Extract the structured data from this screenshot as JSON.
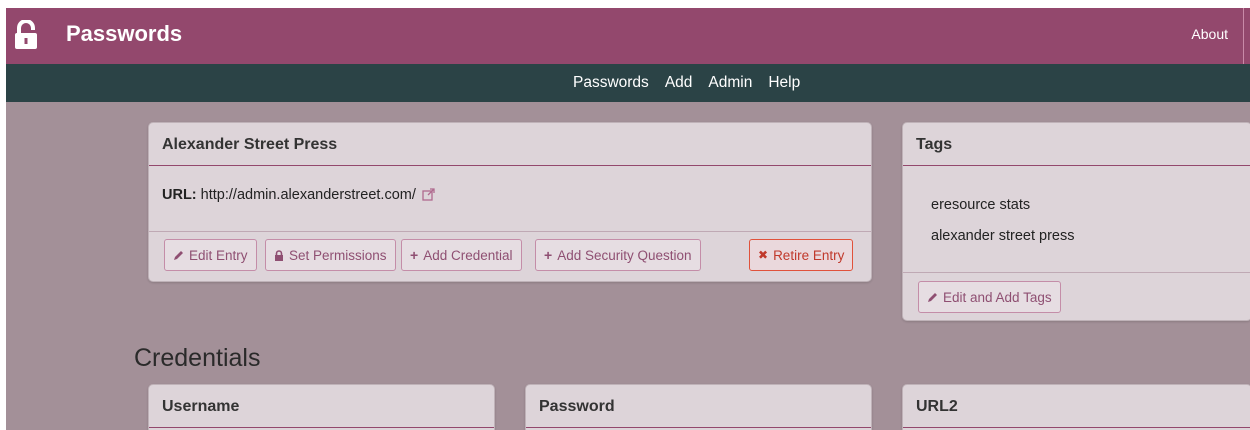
{
  "header": {
    "app_title": "Passwords",
    "about_label": "About"
  },
  "nav": {
    "items": [
      "Passwords",
      "Add",
      "Admin",
      "Help"
    ]
  },
  "entry": {
    "title": "Alexander Street Press",
    "url_label": "URL:",
    "url_value": "http://admin.alexanderstreet.com/",
    "buttons": {
      "edit": "Edit Entry",
      "permissions": "Set Permissions",
      "add_credential": "Add Credential",
      "add_question": "Add Security Question",
      "retire": "Retire Entry"
    }
  },
  "tags": {
    "title": "Tags",
    "items": [
      "eresource stats",
      "alexander street press"
    ],
    "edit_button": "Edit and Add Tags"
  },
  "credentials": {
    "section_title": "Credentials",
    "columns": [
      "Username",
      "Password",
      "URL2"
    ]
  },
  "colors": {
    "brand": "#93486d",
    "navbar": "#2b4346",
    "background": "#a39098",
    "panel": "#ddd4d9",
    "danger": "#c0392b"
  }
}
